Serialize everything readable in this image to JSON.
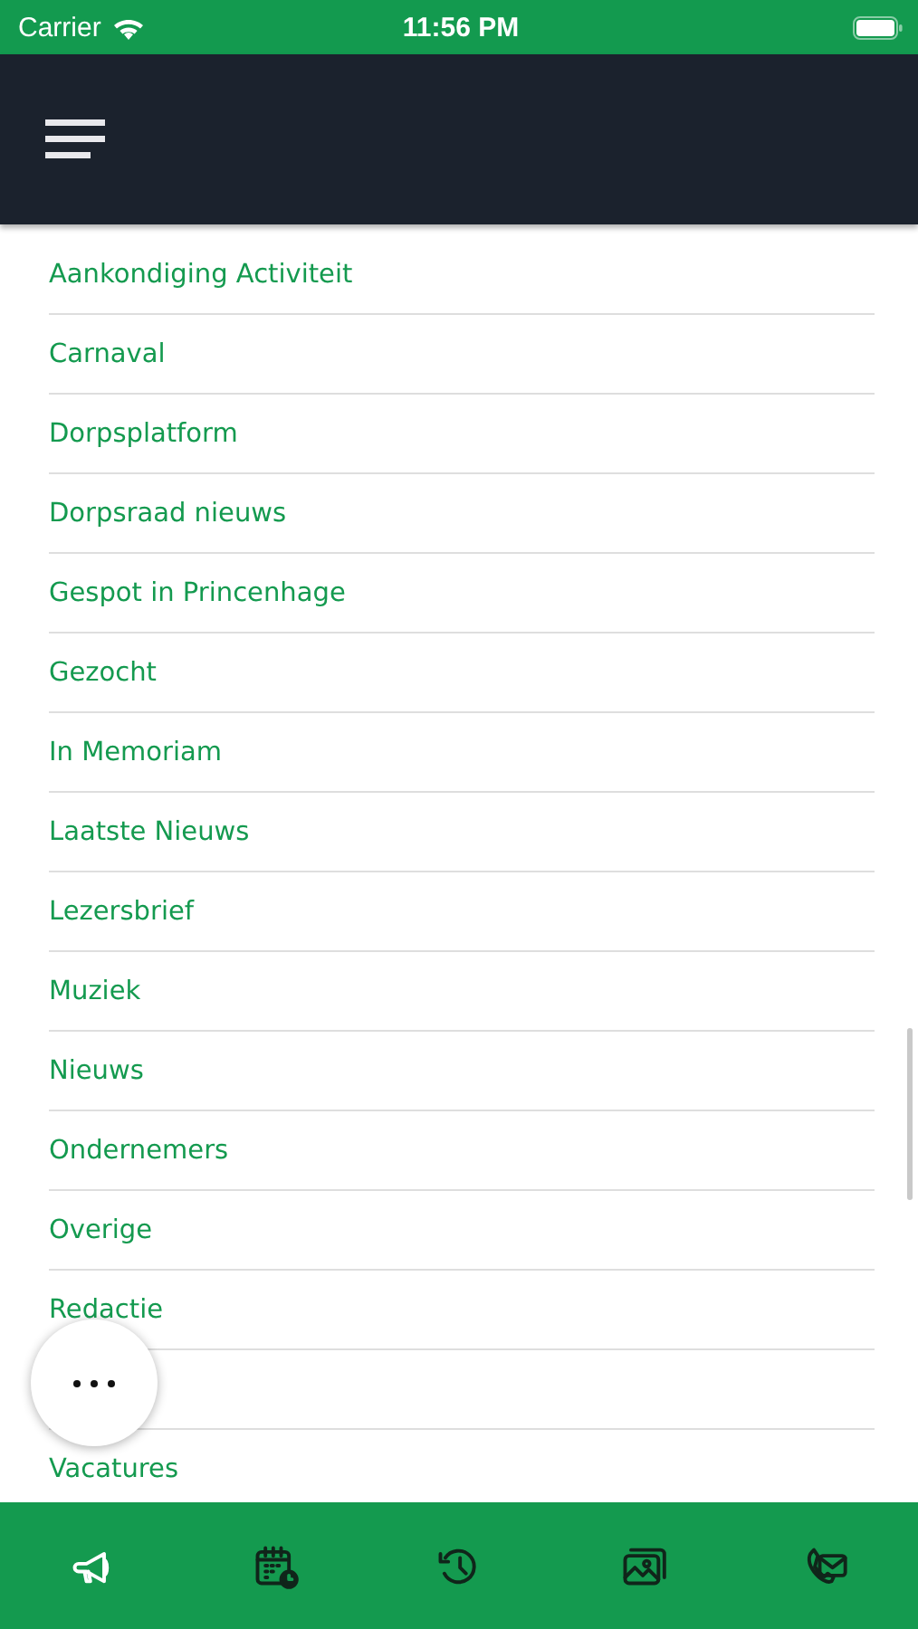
{
  "status_bar": {
    "carrier": "Carrier",
    "time": "11:56 PM"
  },
  "categories": [
    {
      "kind": "link",
      "label": "Aankondiging Activiteit"
    },
    {
      "kind": "link",
      "label": "Carnaval"
    },
    {
      "kind": "link",
      "label": "Dorpsplatform"
    },
    {
      "kind": "link",
      "label": "Dorpsraad nieuws"
    },
    {
      "kind": "link",
      "label": "Gespot in Princenhage"
    },
    {
      "kind": "link",
      "label": "Gezocht"
    },
    {
      "kind": "link",
      "label": "In Memoriam"
    },
    {
      "kind": "link",
      "label": "Laatste Nieuws"
    },
    {
      "kind": "link",
      "label": "Lezersbrief"
    },
    {
      "kind": "link",
      "label": "Muziek"
    },
    {
      "kind": "link",
      "label": "Nieuws"
    },
    {
      "kind": "link",
      "label": "Ondernemers"
    },
    {
      "kind": "link",
      "label": "Overige"
    },
    {
      "kind": "link",
      "label": "Redactie"
    },
    {
      "kind": "blank"
    },
    {
      "kind": "link",
      "label": "Vacatures"
    }
  ],
  "tab_bar": [
    {
      "kind": "megaphone",
      "selected": true
    },
    {
      "kind": "calendar",
      "selected": false
    },
    {
      "kind": "history",
      "selected": false
    },
    {
      "kind": "gallery",
      "selected": false
    },
    {
      "kind": "contact",
      "selected": false
    }
  ]
}
